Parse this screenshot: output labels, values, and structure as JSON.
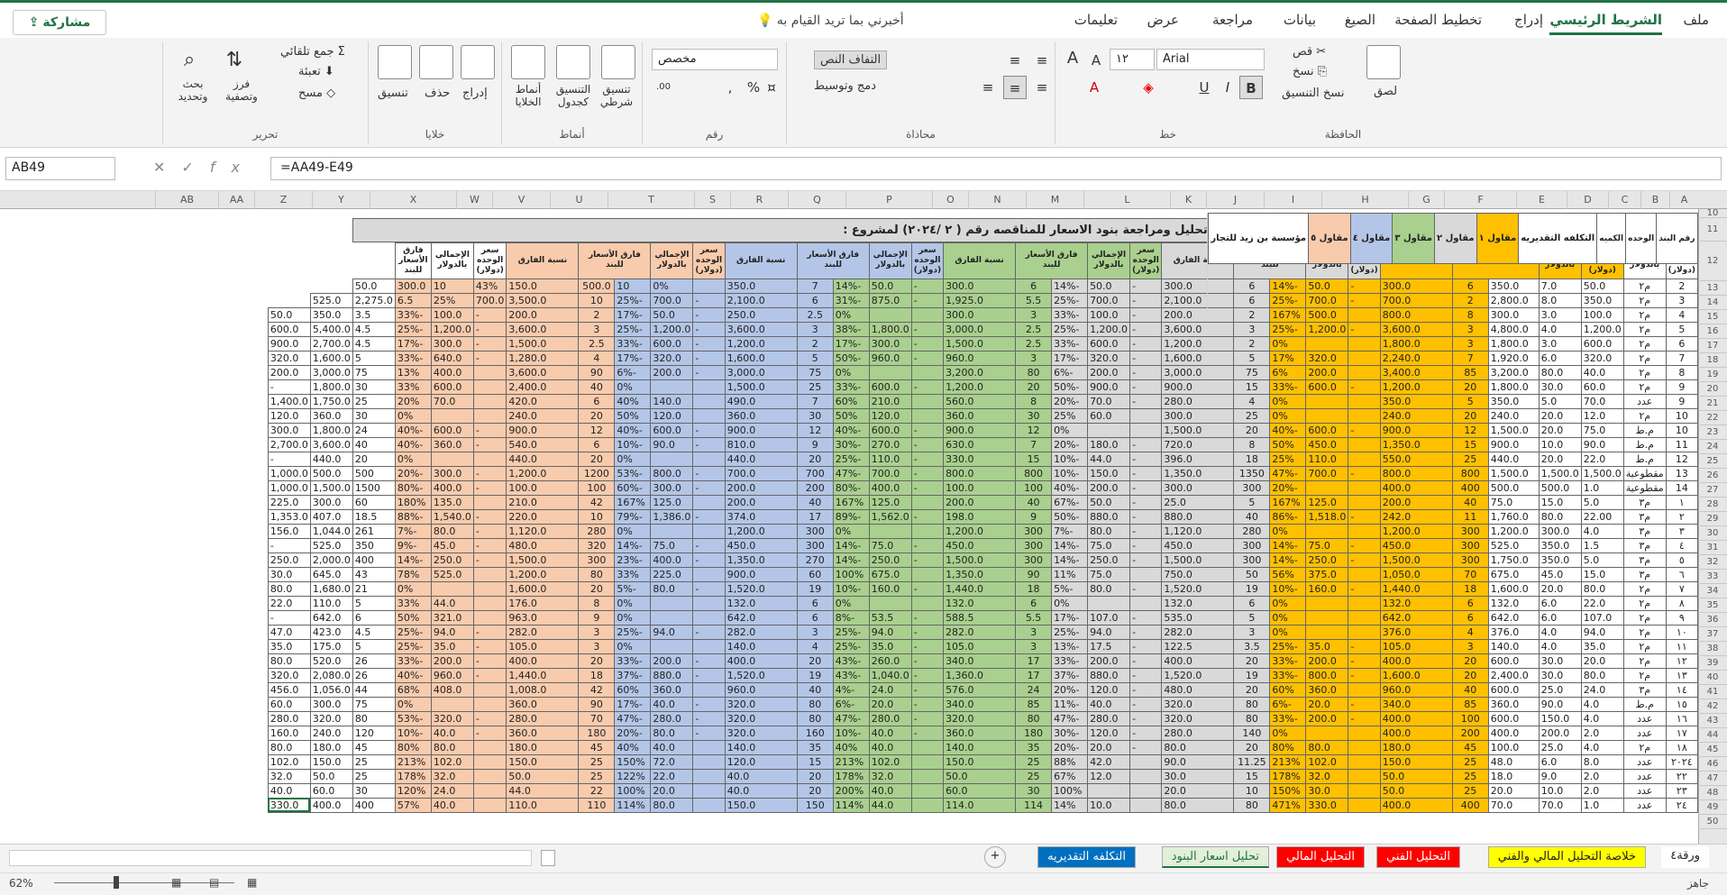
{
  "ribbon_tabs": [
    "ملف",
    "الشريط الرئيسي",
    "إدراج",
    "تخطيط الصفحة",
    "الصيغ",
    "بيانات",
    "مراجعة",
    "عرض",
    "تعليمات"
  ],
  "tell_me": "أخبرني بما تريد القيام به",
  "share_label": "مشاركة",
  "clipboard": {
    "paste": "لصق",
    "cut": "قص",
    "copy": "نسخ",
    "format_painter": "نسخ التنسيق",
    "label": "الحافظة"
  },
  "font": {
    "name": "Arial",
    "size": "١٢",
    "label": "خط"
  },
  "alignment": {
    "wrap": "التفاف النص",
    "merge": "دمج وتوسيط",
    "label": "محاذاة"
  },
  "number": {
    "format": "مخصص",
    "label": "رقم"
  },
  "styles": {
    "conditional": "تنسيق شرطي",
    "as_table": "التنسيق كجدول",
    "cell_styles": "أنماط الخلايا",
    "label": "أنماط"
  },
  "cells": {
    "insert": "إدراج",
    "delete": "حذف",
    "format": "تنسيق",
    "label": "خلايا"
  },
  "editing": {
    "autosum": "جمع تلقائي",
    "fill": "تعبئة",
    "clear": "مسح",
    "sort": "فرز وتصفية",
    "find": "بحث وتحديد",
    "label": "تحرير"
  },
  "name_box": "AB49",
  "formula": "=AA49-E49",
  "columns": [
    "A",
    "B",
    "C",
    "D",
    "E",
    "F",
    "G",
    "H",
    "I",
    "J",
    "K",
    "L",
    "M",
    "N",
    "O",
    "P",
    "Q",
    "R",
    "S",
    "T",
    "U",
    "V",
    "W",
    "X",
    "Y",
    "Z",
    "AA",
    "AB"
  ],
  "title": "تحليل ومراجعة  بنود الاسعار للمناقصه رقم ( ٢ /٢٠٢٤) لمشروع :",
  "groups": {
    "estimate": "التكلفه التقديريه",
    "c1": "مقاول ١",
    "c2": "مقاول ٢",
    "c3": "مقاول ٣",
    "c4": "مقاول ٤",
    "c5": "مقاول ٥",
    "c6": "مؤسسة بن زيد للتجار"
  },
  "headers": {
    "item": "رقم البند",
    "unit": "الوحده",
    "qty": "الكميه",
    "uprice": "سعر الوحده (دولار)",
    "total": "الإجمالي بالدولار",
    "diff": "فارق الأسعار للبند",
    "pct": "نسبة الفارق"
  },
  "row_numbers": [
    "10",
    "11",
    "12",
    "13",
    "14",
    "15",
    "16",
    "17",
    "18",
    "19",
    "20",
    "21",
    "22",
    "23",
    "24",
    "25",
    "26",
    "27",
    "28",
    "29",
    "30",
    "31",
    "32",
    "33",
    "34",
    "35",
    "36",
    "37",
    "38",
    "39",
    "40",
    "41",
    "42",
    "43",
    "44",
    "45",
    "46",
    "47",
    "48",
    "49",
    "50"
  ],
  "rows": [
    [
      "2",
      "م٢",
      "50.0",
      "7.0",
      "350.0",
      "6",
      "300.0",
      "-",
      "50.0",
      "-14%",
      "6",
      "300.0",
      "-",
      "50.0",
      "-14%",
      "6",
      "300.0",
      "-",
      "50.0",
      "-14%",
      "7",
      "350.0",
      "",
      "0%",
      "10",
      "500.0",
      "150.0",
      "43%",
      "10",
      "300.0",
      "50.0"
    ],
    [
      "3",
      "م٢",
      "350.0",
      "8.0",
      "2,800.0",
      "2",
      "700.0",
      "-",
      "700.0",
      "-25%",
      "6",
      "2,100.0",
      "-",
      "700.0",
      "-25%",
      "5.5",
      "1,925.0",
      "-",
      "875.0",
      "-31%",
      "6",
      "2,100.0",
      "-",
      "700.0",
      "-25%",
      "10",
      "3,500.0",
      "700.0",
      "25%",
      "6.5",
      "2,275.0",
      "525.0"
    ],
    [
      "4",
      "م٢",
      "100.0",
      "3.0",
      "300.0",
      "8",
      "800.0",
      "",
      "500.0",
      "167%",
      "2",
      "200.0",
      "-",
      "100.0",
      "-33%",
      "3",
      "300.0",
      "",
      "",
      "0%",
      "2.5",
      "250.0",
      "-",
      "50.0",
      "-17%",
      "2",
      "200.0",
      "-",
      "100.0",
      "-33%",
      "3.5",
      "350.0",
      "50.0"
    ],
    [
      "5",
      "م٢",
      "1,200.0",
      "4.0",
      "4,800.0",
      "3",
      "3,600.0",
      "-",
      "1,200.0",
      "-25%",
      "3",
      "3,600.0",
      "-",
      "1,200.0",
      "-25%",
      "2.5",
      "3,000.0",
      "-",
      "1,800.0",
      "-38%",
      "3",
      "3,600.0",
      "-",
      "1,200.0",
      "-25%",
      "3",
      "3,600.0",
      "-",
      "1,200.0",
      "-25%",
      "4.5",
      "5,400.0",
      "600.0"
    ],
    [
      "6",
      "م٢",
      "600.0",
      "3.0",
      "1,800.0",
      "3",
      "1,800.0",
      "",
      "",
      "0%",
      "2",
      "1,200.0",
      "-",
      "600.0",
      "-33%",
      "2.5",
      "1,500.0",
      "-",
      "300.0",
      "-17%",
      "2",
      "1,200.0",
      "-",
      "600.0",
      "-33%",
      "2.5",
      "1,500.0",
      "-",
      "300.0",
      "-17%",
      "4.5",
      "2,700.0",
      "900.0"
    ],
    [
      "7",
      "م٢",
      "320.0",
      "6.0",
      "1,920.0",
      "7",
      "2,240.0",
      "",
      "320.0",
      "17%",
      "5",
      "1,600.0",
      "-",
      "320.0",
      "-17%",
      "3",
      "960.0",
      "-",
      "960.0",
      "-50%",
      "5",
      "1,600.0",
      "-",
      "320.0",
      "-17%",
      "4",
      "1,280.0",
      "-",
      "640.0",
      "-33%",
      "5",
      "1,600.0",
      "320.0"
    ],
    [
      "8",
      "م٢",
      "40.0",
      "80.0",
      "3,200.0",
      "85",
      "3,400.0",
      "",
      "200.0",
      "6%",
      "75",
      "3,000.0",
      "-",
      "200.0",
      "-6%",
      "80",
      "3,200.0",
      "",
      "",
      "0%",
      "75",
      "3,000.0",
      "-",
      "200.0",
      "-6%",
      "90",
      "3,600.0",
      "",
      "400.0",
      "13%",
      "75",
      "3,000.0",
      "200.0"
    ],
    [
      "9",
      "م٢",
      "60.0",
      "30.0",
      "1,800.0",
      "20",
      "1,200.0",
      "-",
      "600.0",
      "-33%",
      "15",
      "900.0",
      "-",
      "900.0",
      "-50%",
      "20",
      "1,200.0",
      "-",
      "600.0",
      "-33%",
      "25",
      "1,500.0",
      "",
      "",
      "0%",
      "40",
      "2,400.0",
      "",
      "600.0",
      "33%",
      "30",
      "1,800.0",
      "-"
    ],
    [
      "9",
      "عدد",
      "70.0",
      "5.0",
      "350.0",
      "5",
      "350.0",
      "",
      "",
      "0%",
      "4",
      "280.0",
      "-",
      "70.0",
      "-20%",
      "8",
      "560.0",
      "",
      "210.0",
      "60%",
      "7",
      "490.0",
      "",
      "140.0",
      "40%",
      "6",
      "420.0",
      "",
      "70.0",
      "20%",
      "25",
      "1,750.0",
      "1,400.0"
    ],
    [
      "10",
      "م٢",
      "12.0",
      "20.0",
      "240.0",
      "20",
      "240.0",
      "",
      "",
      "0%",
      "25",
      "300.0",
      "",
      "60.0",
      "25%",
      "30",
      "360.0",
      "",
      "120.0",
      "50%",
      "30",
      "360.0",
      "",
      "120.0",
      "50%",
      "20",
      "240.0",
      "",
      "",
      "0%",
      "30",
      "360.0",
      "120.0"
    ],
    [
      "10",
      "م.ط",
      "75.0",
      "20.0",
      "1,500.0",
      "12",
      "900.0",
      "-",
      "600.0",
      "-40%",
      "20",
      "1,500.0",
      "",
      "",
      "0%",
      "12",
      "900.0",
      "-",
      "600.0",
      "-40%",
      "12",
      "900.0",
      "-",
      "600.0",
      "-40%",
      "12",
      "900.0",
      "-",
      "600.0",
      "-40%",
      "24",
      "1,800.0",
      "300.0"
    ],
    [
      "11",
      "م.ط",
      "90.0",
      "10.0",
      "900.0",
      "15",
      "1,350.0",
      "",
      "450.0",
      "50%",
      "8",
      "720.0",
      "-",
      "180.0",
      "-20%",
      "7",
      "630.0",
      "-",
      "270.0",
      "-30%",
      "9",
      "810.0",
      "-",
      "90.0",
      "-10%",
      "6",
      "540.0",
      "-",
      "360.0",
      "-40%",
      "40",
      "3,600.0",
      "2,700.0"
    ],
    [
      "12",
      "م.ط",
      "22.0",
      "20.0",
      "440.0",
      "25",
      "550.0",
      "",
      "110.0",
      "25%",
      "18",
      "396.0",
      "-",
      "44.0",
      "-10%",
      "15",
      "330.0",
      "-",
      "110.0",
      "-25%",
      "20",
      "440.0",
      "",
      "",
      "0%",
      "20",
      "440.0",
      "",
      "",
      "0%",
      "20",
      "440.0",
      "-"
    ],
    [
      "13",
      "مقطوعية",
      "1,500.0",
      "1,500.0",
      "1,500.0",
      "800",
      "800.0",
      "-",
      "700.0",
      "-47%",
      "1350",
      "1,350.0",
      "-",
      "150.0",
      "-10%",
      "800",
      "800.0",
      "-",
      "700.0",
      "-47%",
      "700",
      "700.0",
      "-",
      "800.0",
      "-53%",
      "1200",
      "1,200.0",
      "-",
      "300.0",
      "-20%",
      "500",
      "500.0",
      "1,000.0"
    ],
    [
      "14",
      "مقطوعية",
      "1.0",
      "500.0",
      "500.0",
      "400",
      "400.0",
      "",
      "",
      "-20%",
      "300",
      "300.0",
      "-",
      "200.0",
      "-40%",
      "100",
      "100.0",
      "-",
      "400.0",
      "-80%",
      "200",
      "200.0",
      "-",
      "300.0",
      "-60%",
      "100",
      "100.0",
      "-",
      "400.0",
      "-80%",
      "1500",
      "1,500.0",
      "1,000.0"
    ],
    [
      "١",
      "م٣",
      "5.0",
      "15.0",
      "75.0",
      "40",
      "200.0",
      "",
      "125.0",
      "167%",
      "5",
      "25.0",
      "-",
      "50.0",
      "-67%",
      "40",
      "200.0",
      "",
      "125.0",
      "167%",
      "40",
      "200.0",
      "",
      "125.0",
      "167%",
      "42",
      "210.0",
      "",
      "135.0",
      "180%",
      "60",
      "300.0",
      "225.0"
    ],
    [
      "٢",
      "م٣",
      "22.00",
      "80.0",
      "1,760.0",
      "11",
      "242.0",
      "-",
      "1,518.0",
      "-86%",
      "40",
      "880.0",
      "-",
      "880.0",
      "-50%",
      "9",
      "198.0",
      "-",
      "1,562.0",
      "-89%",
      "17",
      "374.0",
      "-",
      "1,386.0",
      "-79%",
      "10",
      "220.0",
      "-",
      "1,540.0",
      "-88%",
      "18.5",
      "407.0",
      "1,353.0"
    ],
    [
      "٣",
      "م٣",
      "4.0",
      "300.0",
      "1,200.0",
      "300",
      "1,200.0",
      "",
      "",
      "0%",
      "280",
      "1,120.0",
      "-",
      "80.0",
      "-7%",
      "300",
      "1,200.0",
      "",
      "",
      "0%",
      "300",
      "1,200.0",
      "",
      "",
      "0%",
      "280",
      "1,120.0",
      "-",
      "80.0",
      "-7%",
      "261",
      "1,044.0",
      "156.0"
    ],
    [
      "٤",
      "م٣",
      "1.5",
      "350.0",
      "525.0",
      "300",
      "450.0",
      "-",
      "75.0",
      "-14%",
      "300",
      "450.0",
      "-",
      "75.0",
      "-14%",
      "300",
      "450.0",
      "-",
      "75.0",
      "-14%",
      "300",
      "450.0",
      "-",
      "75.0",
      "-14%",
      "320",
      "480.0",
      "-",
      "45.0",
      "-9%",
      "350",
      "525.0",
      "-"
    ],
    [
      "٥",
      "م٣",
      "5.0",
      "350.0",
      "1,750.0",
      "300",
      "1,500.0",
      "-",
      "250.0",
      "-14%",
      "300",
      "1,500.0",
      "-",
      "250.0",
      "-14%",
      "300",
      "1,500.0",
      "-",
      "250.0",
      "-14%",
      "270",
      "1,350.0",
      "-",
      "400.0",
      "-23%",
      "300",
      "1,500.0",
      "-",
      "250.0",
      "-14%",
      "400",
      "2,000.0",
      "250.0"
    ],
    [
      "٦",
      "م٣",
      "15.0",
      "45.0",
      "675.0",
      "70",
      "1,050.0",
      "",
      "375.0",
      "56%",
      "50",
      "750.0",
      "",
      "75.0",
      "11%",
      "90",
      "1,350.0",
      "",
      "675.0",
      "100%",
      "60",
      "900.0",
      "",
      "225.0",
      "33%",
      "80",
      "1,200.0",
      "",
      "525.0",
      "78%",
      "43",
      "645.0",
      "30.0"
    ],
    [
      "٧",
      "م٢",
      "80.0",
      "20.0",
      "1,600.0",
      "18",
      "1,440.0",
      "-",
      "160.0",
      "-10%",
      "19",
      "1,520.0",
      "-",
      "80.0",
      "-5%",
      "18",
      "1,440.0",
      "-",
      "160.0",
      "-10%",
      "19",
      "1,520.0",
      "-",
      "80.0",
      "-5%",
      "20",
      "1,600.0",
      "",
      "",
      "0%",
      "21",
      "1,680.0",
      "80.0"
    ],
    [
      "٨",
      "م٢",
      "22.0",
      "6.0",
      "132.0",
      "6",
      "132.0",
      "",
      "",
      "0%",
      "6",
      "132.0",
      "",
      "",
      "0%",
      "6",
      "132.0",
      "",
      "",
      "0%",
      "6",
      "132.0",
      "",
      "",
      "0%",
      "8",
      "176.0",
      "",
      "44.0",
      "33%",
      "5",
      "110.0",
      "22.0"
    ],
    [
      "٩",
      "م٢",
      "107.0",
      "6.0",
      "642.0",
      "6",
      "642.0",
      "",
      "",
      "0%",
      "5",
      "535.0",
      "-",
      "107.0",
      "-17%",
      "5.5",
      "588.5",
      "-",
      "53.5",
      "-8%",
      "6",
      "642.0",
      "",
      "",
      "0%",
      "9",
      "963.0",
      "",
      "321.0",
      "50%",
      "6",
      "642.0",
      "-"
    ],
    [
      "١٠",
      "م٢",
      "94.0",
      "4.0",
      "376.0",
      "4",
      "376.0",
      "",
      "",
      "0%",
      "3",
      "282.0",
      "-",
      "94.0",
      "-25%",
      "3",
      "282.0",
      "-",
      "94.0",
      "-25%",
      "3",
      "282.0",
      "-",
      "94.0",
      "-25%",
      "3",
      "282.0",
      "-",
      "94.0",
      "-25%",
      "4.5",
      "423.0",
      "47.0"
    ],
    [
      "١١",
      "م٢",
      "35.0",
      "4.0",
      "140.0",
      "3",
      "105.0",
      "-",
      "35.0",
      "-25%",
      "3.5",
      "122.5",
      "-",
      "17.5",
      "-13%",
      "3",
      "105.0",
      "-",
      "35.0",
      "-25%",
      "4",
      "140.0",
      "",
      "",
      "0%",
      "3",
      "105.0",
      "-",
      "35.0",
      "-25%",
      "5",
      "175.0",
      "35.0"
    ],
    [
      "١٢",
      "م٢",
      "20.0",
      "30.0",
      "600.0",
      "20",
      "400.0",
      "-",
      "200.0",
      "-33%",
      "20",
      "400.0",
      "-",
      "200.0",
      "-33%",
      "17",
      "340.0",
      "-",
      "260.0",
      "-43%",
      "20",
      "400.0",
      "-",
      "200.0",
      "-33%",
      "20",
      "400.0",
      "-",
      "200.0",
      "-33%",
      "26",
      "520.0",
      "80.0"
    ],
    [
      "١٣",
      "م٢",
      "80.0",
      "30.0",
      "2,400.0",
      "20",
      "1,600.0",
      "-",
      "800.0",
      "-33%",
      "19",
      "1,520.0",
      "-",
      "880.0",
      "-37%",
      "17",
      "1,360.0",
      "-",
      "1,040.0",
      "-43%",
      "19",
      "1,520.0",
      "-",
      "880.0",
      "-37%",
      "18",
      "1,440.0",
      "-",
      "960.0",
      "-40%",
      "26",
      "2,080.0",
      "320.0"
    ],
    [
      "١٤",
      "م٣",
      "24.0",
      "25.0",
      "600.0",
      "40",
      "960.0",
      "",
      "360.0",
      "60%",
      "20",
      "480.0",
      "-",
      "120.0",
      "-20%",
      "24",
      "576.0",
      "-",
      "24.0",
      "-4%",
      "40",
      "960.0",
      "",
      "360.0",
      "60%",
      "42",
      "1,008.0",
      "",
      "408.0",
      "68%",
      "44",
      "1,056.0",
      "456.0"
    ],
    [
      "١٥",
      "م.ط",
      "4.0",
      "90.0",
      "360.0",
      "85",
      "340.0",
      "-",
      "20.0",
      "-6%",
      "80",
      "320.0",
      "-",
      "40.0",
      "-11%",
      "85",
      "340.0",
      "-",
      "20.0",
      "-6%",
      "80",
      "320.0",
      "-",
      "40.0",
      "-17%",
      "90",
      "360.0",
      "",
      "",
      "0%",
      "75",
      "300.0",
      "60.0"
    ],
    [
      "١٦",
      "عدد",
      "4.0",
      "150.0",
      "600.0",
      "100",
      "400.0",
      "-",
      "200.0",
      "-33%",
      "80",
      "320.0",
      "-",
      "280.0",
      "-47%",
      "80",
      "320.0",
      "-",
      "280.0",
      "-47%",
      "80",
      "320.0",
      "-",
      "280.0",
      "-47%",
      "70",
      "280.0",
      "-",
      "320.0",
      "-53%",
      "80",
      "320.0",
      "280.0"
    ],
    [
      "١٧",
      "عدد",
      "2.0",
      "200.0",
      "400.0",
      "200",
      "400.0",
      "",
      "",
      "0%",
      "140",
      "280.0",
      "-",
      "120.0",
      "-30%",
      "180",
      "360.0",
      "-",
      "40.0",
      "-10%",
      "160",
      "320.0",
      "-",
      "80.0",
      "-20%",
      "180",
      "360.0",
      "-",
      "40.0",
      "-10%",
      "120",
      "240.0",
      "160.0"
    ],
    [
      "١٨",
      "م٢",
      "4.0",
      "25.0",
      "100.0",
      "45",
      "180.0",
      "",
      "80.0",
      "80%",
      "20",
      "80.0",
      "-",
      "20.0",
      "-20%",
      "35",
      "140.0",
      "",
      "40.0",
      "40%",
      "35",
      "140.0",
      "",
      "40.0",
      "40%",
      "45",
      "180.0",
      "",
      "80.0",
      "80%",
      "45",
      "180.0",
      "80.0"
    ],
    [
      "٢٠٢٤",
      "عدد",
      "8.0",
      "6.0",
      "48.0",
      "25",
      "150.0",
      "",
      "102.0",
      "213%",
      "11.25",
      "90.0",
      "",
      "42.0",
      "88%",
      "25",
      "150.0",
      "",
      "102.0",
      "213%",
      "15",
      "120.0",
      "",
      "72.0",
      "150%",
      "25",
      "150.0",
      "",
      "102.0",
      "213%",
      "25",
      "150.0",
      "102.0"
    ],
    [
      "٢٢",
      "عدد",
      "2.0",
      "9.0",
      "18.0",
      "25",
      "50.0",
      "",
      "32.0",
      "178%",
      "15",
      "30.0",
      "",
      "12.0",
      "67%",
      "25",
      "50.0",
      "",
      "32.0",
      "178%",
      "20",
      "40.0",
      "",
      "22.0",
      "122%",
      "25",
      "50.0",
      "",
      "32.0",
      "178%",
      "25",
      "50.0",
      "32.0"
    ],
    [
      "٢٣",
      "عدد",
      "2.0",
      "10.0",
      "20.0",
      "25",
      "50.0",
      "",
      "30.0",
      "150%",
      "10",
      "20.0",
      "",
      "",
      "100%",
      "30",
      "60.0",
      "",
      "40.0",
      "200%",
      "20",
      "40.0",
      "",
      "20.0",
      "100%",
      "22",
      "44.0",
      "",
      "24.0",
      "120%",
      "30",
      "60.0",
      "40.0"
    ],
    [
      "٢٤",
      "عدد",
      "1.0",
      "70.0",
      "70.0",
      "400",
      "400.0",
      "",
      "330.0",
      "471%",
      "80",
      "80.0",
      "",
      "10.0",
      "14%",
      "114",
      "114.0",
      "",
      "44.0",
      "114%",
      "150",
      "150.0",
      "",
      "80.0",
      "114%",
      "110",
      "110.0",
      "",
      "40.0",
      "57%",
      "400",
      "400.0",
      "330.0"
    ]
  ],
  "sheet_tabs": [
    "ورقة٤",
    "خلاصة التحليل المالي والفني",
    "التحليل الفني",
    "التحليل المالي",
    "تحليل اسعار البنود",
    "التكلفه التقديريه"
  ],
  "status_ready": "جاهز",
  "zoom": "62%"
}
